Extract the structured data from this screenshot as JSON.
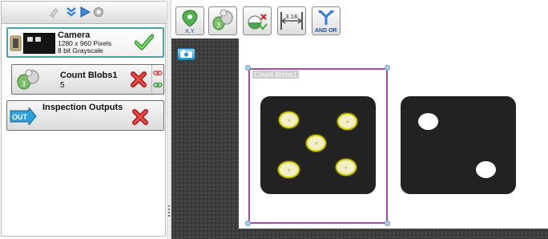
{
  "steps": {
    "camera": {
      "title": "Camera",
      "resolution": "1280 x 960 Pixels",
      "format": "8 bit Grayscale",
      "status_icon": "check-icon"
    },
    "count_blobs": {
      "title": "Count Blobs1",
      "result": "5",
      "status_icon": "x-icon"
    },
    "outputs": {
      "title": "Inspection Outputs",
      "badge": "OUT",
      "status_icon": "x-icon"
    }
  },
  "toolbar": {
    "tools": [
      {
        "icon": "pin-xy-icon",
        "label": "X,Y"
      },
      {
        "icon": "count-blobs-icon",
        "label": "3"
      },
      {
        "icon": "presence-check-icon",
        "label": ""
      },
      {
        "icon": "measure-icon",
        "label": "3.16"
      },
      {
        "icon": "and-or-icon",
        "label": "AND OR"
      }
    ]
  },
  "viewer": {
    "roi_label": "Count Blobs1",
    "blobs_found": 5
  },
  "colors": {
    "selected_border": "#4ba2ad",
    "roi_border": "#a24da8",
    "blob_highlight": "#d8d20a",
    "pass_green": "#3aa83a",
    "fail_red": "#d62020"
  }
}
